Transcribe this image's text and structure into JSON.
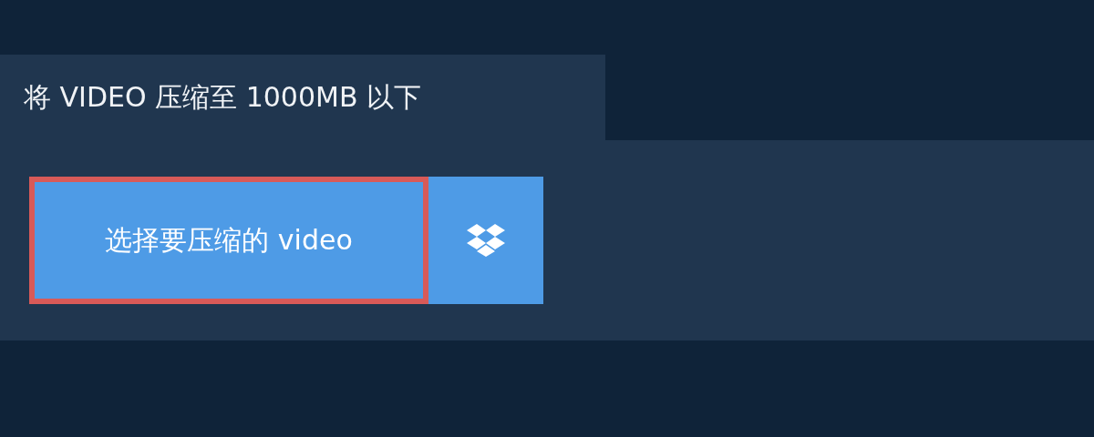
{
  "tab": {
    "title": "将 VIDEO 压缩至 1000MB 以下"
  },
  "upload": {
    "button": "选择要压缩的 video",
    "focused": true
  }
}
